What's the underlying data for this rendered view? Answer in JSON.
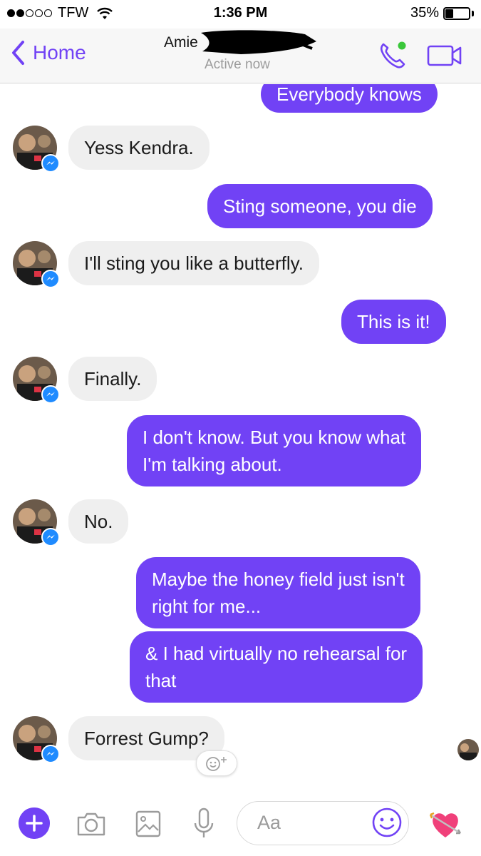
{
  "status_bar": {
    "carrier": "TFW",
    "time": "1:36 PM",
    "battery": "35%",
    "battery_level": 0.35
  },
  "header": {
    "back_label": "Home",
    "contact_name": "Amie",
    "status": "Active now",
    "accent_color": "#7142f5",
    "online_color": "#3ac73a"
  },
  "messages": [
    {
      "side": "out",
      "text": "Everybody knows"
    },
    {
      "side": "in",
      "text": "Yess Kendra."
    },
    {
      "side": "out",
      "text": "Sting someone, you die"
    },
    {
      "side": "in",
      "text": "I'll sting you like a butterfly."
    },
    {
      "side": "out",
      "text": "This is it!"
    },
    {
      "side": "in",
      "text": "Finally."
    },
    {
      "side": "out",
      "lines": [
        "I don't know. But you know what",
        "I'm talking about."
      ]
    },
    {
      "side": "in",
      "text": "No."
    },
    {
      "side": "out",
      "lines": [
        "Maybe the honey field just isn't",
        "right for me..."
      ]
    },
    {
      "side": "out",
      "lines": [
        "& I had virtually no rehearsal for",
        "that"
      ]
    },
    {
      "side": "in",
      "text": "Forrest Gump?"
    }
  ],
  "composer": {
    "placeholder": "Aa",
    "icons": [
      "plus-icon",
      "camera-icon",
      "image-icon",
      "microphone-icon",
      "emoji-icon",
      "heart-arrow-icon"
    ]
  },
  "colors": {
    "outgoing_bubble": "#7142f5",
    "incoming_bubble": "#efefef",
    "messenger_badge": "#1f8bff"
  }
}
